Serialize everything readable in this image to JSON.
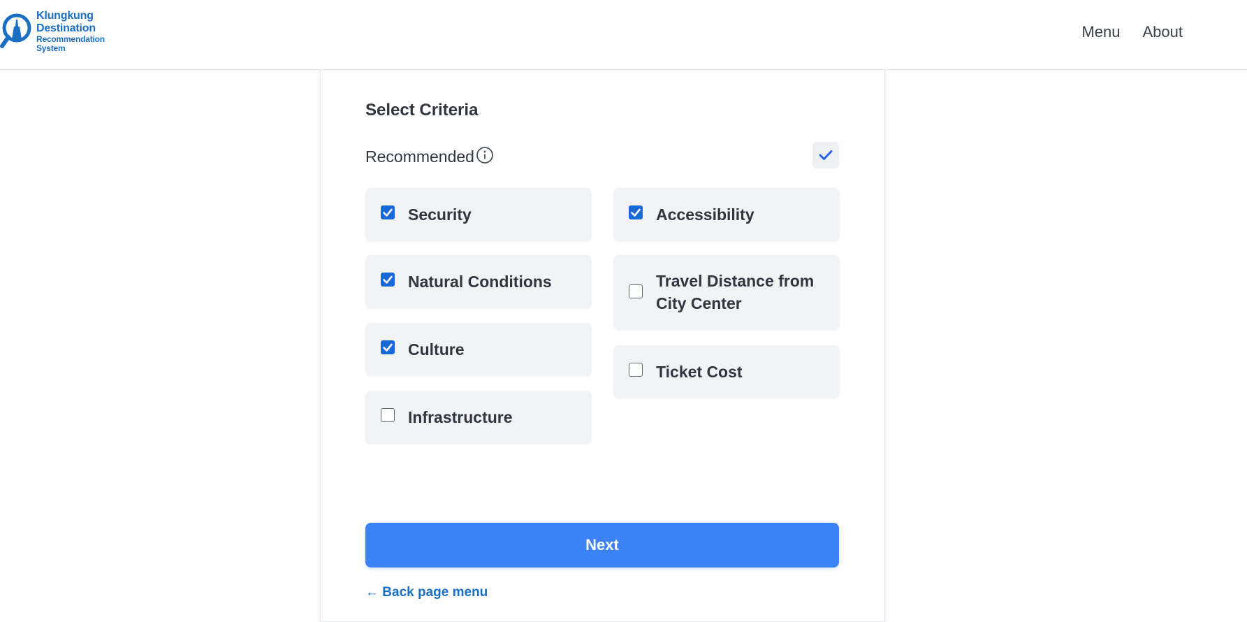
{
  "header": {
    "logo": {
      "line1": "Klungkung",
      "line2": "Destination",
      "line3": "Recommendation",
      "line4": "System",
      "color": "#1a6fc4",
      "icon": "magnifier-temple-icon"
    },
    "nav": [
      {
        "label": "Menu"
      },
      {
        "label": "About"
      }
    ]
  },
  "form": {
    "title": "Select Criteria",
    "recommended": {
      "label": "Recommended",
      "icon": "info-icon",
      "checked": true
    },
    "criteria_left": [
      {
        "label": "Security",
        "checked": true
      },
      {
        "label": "Natural Conditions",
        "checked": true
      },
      {
        "label": "Culture",
        "checked": true
      },
      {
        "label": "Infrastructure",
        "checked": false
      }
    ],
    "criteria_right": [
      {
        "label": "Accessibility",
        "checked": true
      },
      {
        "label": "Travel Distance from City Center",
        "checked": false
      },
      {
        "label": "Ticket Cost",
        "checked": false
      }
    ],
    "next_label": "Next",
    "back_label": "← Back page menu"
  },
  "colors": {
    "accent": "#3b82f6",
    "checkbox": "#1769d6",
    "link": "#1a6fc4"
  }
}
